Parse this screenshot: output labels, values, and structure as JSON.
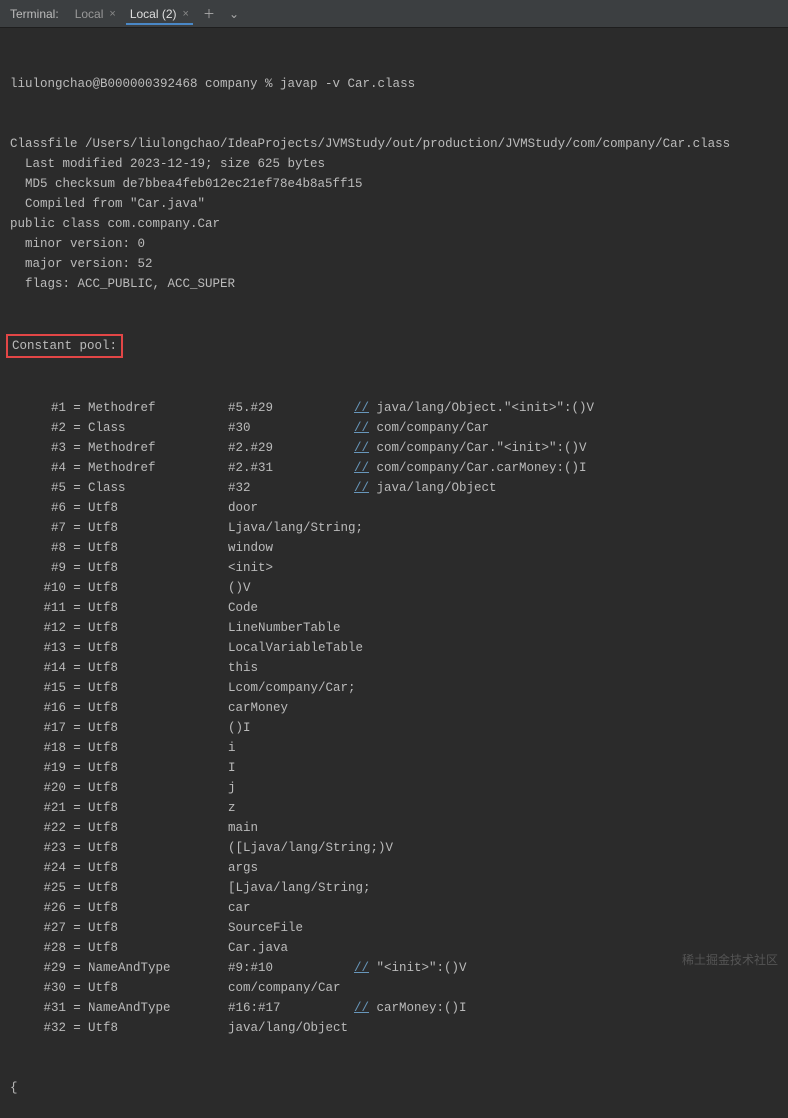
{
  "tabbar": {
    "title": "Terminal:",
    "tabs": [
      {
        "label": "Local",
        "active": false
      },
      {
        "label": "Local (2)",
        "active": true
      }
    ]
  },
  "prompt": "liulongchao@B000000392468 company % javap -v Car.class",
  "header_lines": [
    "Classfile /Users/liulongchao/IdeaProjects/JVMStudy/out/production/JVMStudy/com/company/Car.class",
    "  Last modified 2023-12-19; size 625 bytes",
    "  MD5 checksum de7bbea4feb012ec21ef78e4b8a5ff15",
    "  Compiled from \"Car.java\"",
    "public class com.company.Car",
    "  minor version: 0",
    "  major version: 52",
    "  flags: ACC_PUBLIC, ACC_SUPER"
  ],
  "constant_pool_label": "Constant pool:",
  "constant_pool": [
    {
      "idx": "#1",
      "type": "Methodref",
      "ref": "#5.#29",
      "comment": "java/lang/Object.\"<init>\":()V"
    },
    {
      "idx": "#2",
      "type": "Class",
      "ref": "#30",
      "comment": "com/company/Car"
    },
    {
      "idx": "#3",
      "type": "Methodref",
      "ref": "#2.#29",
      "comment": "com/company/Car.\"<init>\":()V"
    },
    {
      "idx": "#4",
      "type": "Methodref",
      "ref": "#2.#31",
      "comment": "com/company/Car.carMoney:()I"
    },
    {
      "idx": "#5",
      "type": "Class",
      "ref": "#32",
      "comment": "java/lang/Object"
    },
    {
      "idx": "#6",
      "type": "Utf8",
      "ref": "door",
      "comment": ""
    },
    {
      "idx": "#7",
      "type": "Utf8",
      "ref": "Ljava/lang/String;",
      "comment": ""
    },
    {
      "idx": "#8",
      "type": "Utf8",
      "ref": "window",
      "comment": ""
    },
    {
      "idx": "#9",
      "type": "Utf8",
      "ref": "<init>",
      "comment": ""
    },
    {
      "idx": "#10",
      "type": "Utf8",
      "ref": "()V",
      "comment": ""
    },
    {
      "idx": "#11",
      "type": "Utf8",
      "ref": "Code",
      "comment": ""
    },
    {
      "idx": "#12",
      "type": "Utf8",
      "ref": "LineNumberTable",
      "comment": ""
    },
    {
      "idx": "#13",
      "type": "Utf8",
      "ref": "LocalVariableTable",
      "comment": ""
    },
    {
      "idx": "#14",
      "type": "Utf8",
      "ref": "this",
      "comment": ""
    },
    {
      "idx": "#15",
      "type": "Utf8",
      "ref": "Lcom/company/Car;",
      "comment": ""
    },
    {
      "idx": "#16",
      "type": "Utf8",
      "ref": "carMoney",
      "comment": ""
    },
    {
      "idx": "#17",
      "type": "Utf8",
      "ref": "()I",
      "comment": ""
    },
    {
      "idx": "#18",
      "type": "Utf8",
      "ref": "i",
      "comment": ""
    },
    {
      "idx": "#19",
      "type": "Utf8",
      "ref": "I",
      "comment": ""
    },
    {
      "idx": "#20",
      "type": "Utf8",
      "ref": "j",
      "comment": ""
    },
    {
      "idx": "#21",
      "type": "Utf8",
      "ref": "z",
      "comment": ""
    },
    {
      "idx": "#22",
      "type": "Utf8",
      "ref": "main",
      "comment": ""
    },
    {
      "idx": "#23",
      "type": "Utf8",
      "ref": "([Ljava/lang/String;)V",
      "comment": ""
    },
    {
      "idx": "#24",
      "type": "Utf8",
      "ref": "args",
      "comment": ""
    },
    {
      "idx": "#25",
      "type": "Utf8",
      "ref": "[Ljava/lang/String;",
      "comment": ""
    },
    {
      "idx": "#26",
      "type": "Utf8",
      "ref": "car",
      "comment": ""
    },
    {
      "idx": "#27",
      "type": "Utf8",
      "ref": "SourceFile",
      "comment": ""
    },
    {
      "idx": "#28",
      "type": "Utf8",
      "ref": "Car.java",
      "comment": ""
    },
    {
      "idx": "#29",
      "type": "NameAndType",
      "ref": "#9:#10",
      "comment": "\"<init>\":()V"
    },
    {
      "idx": "#30",
      "type": "Utf8",
      "ref": "com/company/Car",
      "comment": ""
    },
    {
      "idx": "#31",
      "type": "NameAndType",
      "ref": "#16:#17",
      "comment": "carMoney:()I"
    },
    {
      "idx": "#32",
      "type": "Utf8",
      "ref": "java/lang/Object",
      "comment": ""
    }
  ],
  "trailing": "{",
  "watermark": "稀土掘金技术社区"
}
